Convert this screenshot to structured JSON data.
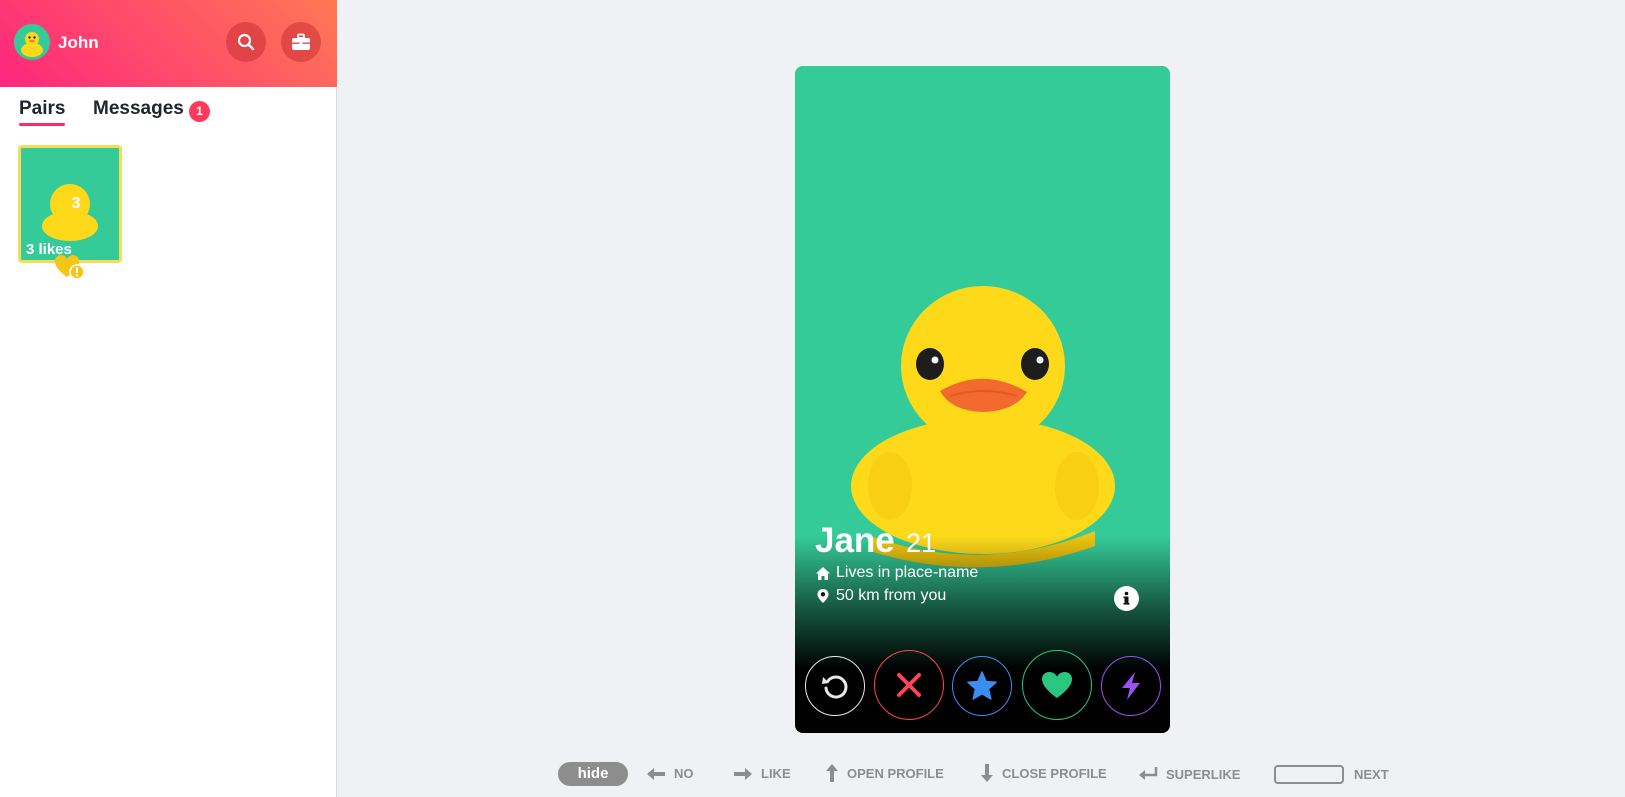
{
  "sidebar": {
    "user": {
      "name": "John",
      "avatar_icon": "duck-avatar"
    },
    "header_buttons": [
      {
        "name": "search-icon"
      },
      {
        "name": "briefcase-icon"
      }
    ],
    "tabs": {
      "pairs_label": "Pairs",
      "messages_label": "Messages",
      "messages_badge": "1"
    },
    "likes_card": {
      "count": "3",
      "label": "3 likes"
    }
  },
  "card": {
    "name": "Jane",
    "age": "21",
    "home": "Lives in place-name",
    "distance": "50 km from you",
    "actions": [
      "rewind",
      "nope",
      "superlike",
      "like",
      "boost"
    ]
  },
  "hints": {
    "hide_label": "hide",
    "no_label": "NO",
    "like_label": "LIKE",
    "open_label": "OPEN PROFILE",
    "close_label": "CLOSE PROFILE",
    "superlike_label": "SUPERLIKE",
    "next_label": "NEXT"
  },
  "colors": {
    "brand_gradient_start": "#fd267d",
    "brand_gradient_end": "#ff7854",
    "card_bg": "#34cb98",
    "duck_yellow": "#fdd91a",
    "nope": "#ff4458",
    "superlike": "#3c8df0",
    "like": "#2bc67f",
    "boost": "#9a52f0"
  }
}
